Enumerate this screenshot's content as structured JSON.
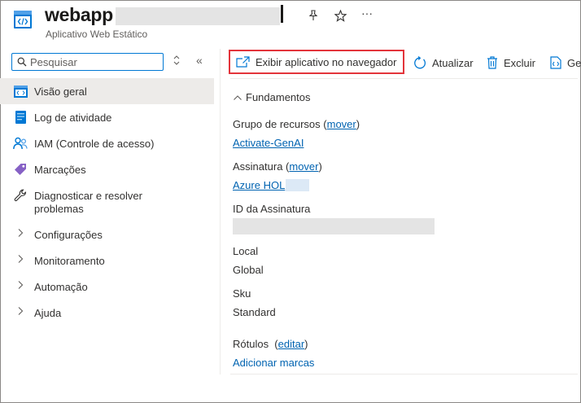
{
  "header": {
    "title": "webapp",
    "subtitle": "Aplicativo Web Estático",
    "pin_icon": "pin-icon",
    "favorite_icon": "star-icon",
    "more": "···"
  },
  "search": {
    "placeholder": "Pesquisar",
    "expand_icon": "up-down-icon",
    "collapse_label": "«"
  },
  "sidebar": {
    "items": [
      {
        "label": "Visão geral",
        "icon": "overview-icon",
        "active": true
      },
      {
        "label": "Log de atividade",
        "icon": "activity-log-icon"
      },
      {
        "label": "IAM (Controle de acesso)",
        "icon": "iam-icon"
      },
      {
        "label": "Marcações",
        "icon": "tag-icon"
      },
      {
        "label": "Diagnosticar e resolver problemas",
        "icon": "wrench-icon"
      },
      {
        "label": "Configurações",
        "icon": "chevron-right-icon"
      },
      {
        "label": "Monitoramento",
        "icon": "chevron-right-icon"
      },
      {
        "label": "Automação",
        "icon": "chevron-right-icon"
      },
      {
        "label": "Ajuda",
        "icon": "chevron-right-icon"
      }
    ]
  },
  "toolbar": {
    "browse_label": "Exibir aplicativo no navegador",
    "refresh_label": "Atualizar",
    "delete_label": "Excluir",
    "more_label": "Ge"
  },
  "essentials": {
    "heading": "Fundamentos",
    "resource_group_label": "Grupo de recursos",
    "resource_group_move": "mover",
    "resource_group_value": "Activate-GenAI",
    "subscription_label": "Assinatura",
    "subscription_move": "mover",
    "subscription_value": "Azure HOL",
    "subscription_id_label": "ID da Assinatura",
    "location_label": "Local",
    "location_value": "Global",
    "sku_label": "Sku",
    "sku_value": "Standard",
    "tags_label": "Rótulos",
    "tags_edit": "editar",
    "tags_add": "Adicionar marcas"
  },
  "colors": {
    "accent": "#0078d4",
    "link": "#0063b1",
    "highlight_border": "#e3343b",
    "active_bg": "#edebe9"
  }
}
